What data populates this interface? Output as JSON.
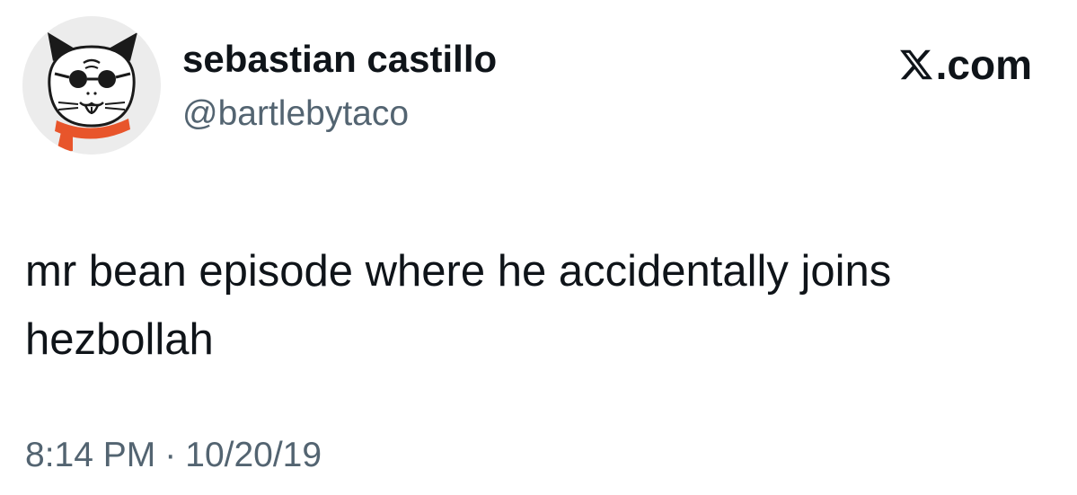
{
  "author": {
    "display_name": "sebastian castillo",
    "handle": "@bartlebytaco",
    "avatar_icon": "cartoon-cat-with-sunglasses-and-orange-scarf"
  },
  "brand": {
    "text": ".com",
    "icon": "x-logo-icon"
  },
  "tweet": {
    "lines": [
      "mr bean episode where he accidentally joins",
      "hezbollah"
    ]
  },
  "meta": {
    "time": "8:14 PM",
    "separator": "·",
    "date": "10/20/19"
  },
  "colors": {
    "text_primary": "#0f1419",
    "text_secondary": "#536471",
    "scarf": "#e8552b",
    "background": "#ffffff"
  }
}
